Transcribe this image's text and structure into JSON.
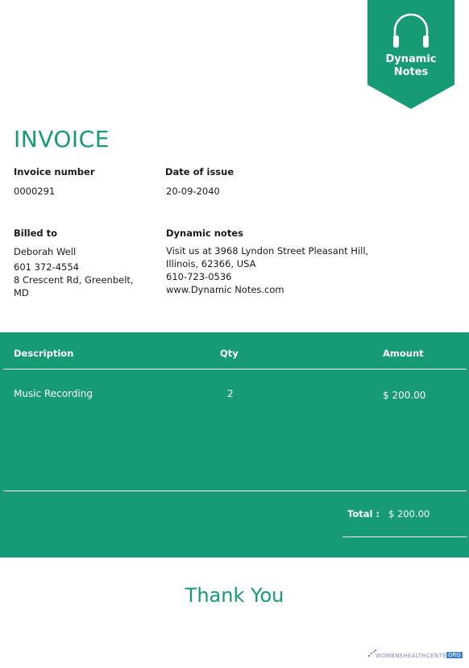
{
  "brand": {
    "name_line1": "Dynamic",
    "name_line2": "Notes",
    "color": "#169b76"
  },
  "invoice": {
    "title": "INVOICE",
    "number_label": "Invoice number",
    "number": "0000291",
    "date_label": "Date of issue",
    "date": "20-09-2040"
  },
  "billed_to": {
    "label": "Billed to",
    "name": "Deborah Well",
    "phone": "601 372-4554",
    "address_line1": "8 Crescent Rd, Greenbelt,",
    "address_line2": "MD"
  },
  "company": {
    "label": "Dynamic notes",
    "line1": "Visit us at 3968 Lyndon Street Pleasant Hill,",
    "line2": "Illinois, 62366, USA",
    "phone": "610-723-0536",
    "website": "www.Dynamic Notes.com"
  },
  "table": {
    "headers": {
      "description": "Description",
      "qty": "Qty",
      "amount": "Amount"
    },
    "rows": [
      {
        "description": "Music Recording",
        "qty": "2",
        "amount": "$ 200.00"
      }
    ],
    "total_label": "Total :",
    "total_value": "$ 200.00"
  },
  "footer": {
    "thanks": "Thank You",
    "watermark": "WOMENSHEALTHCENTER",
    "watermark_org": "ORG"
  }
}
